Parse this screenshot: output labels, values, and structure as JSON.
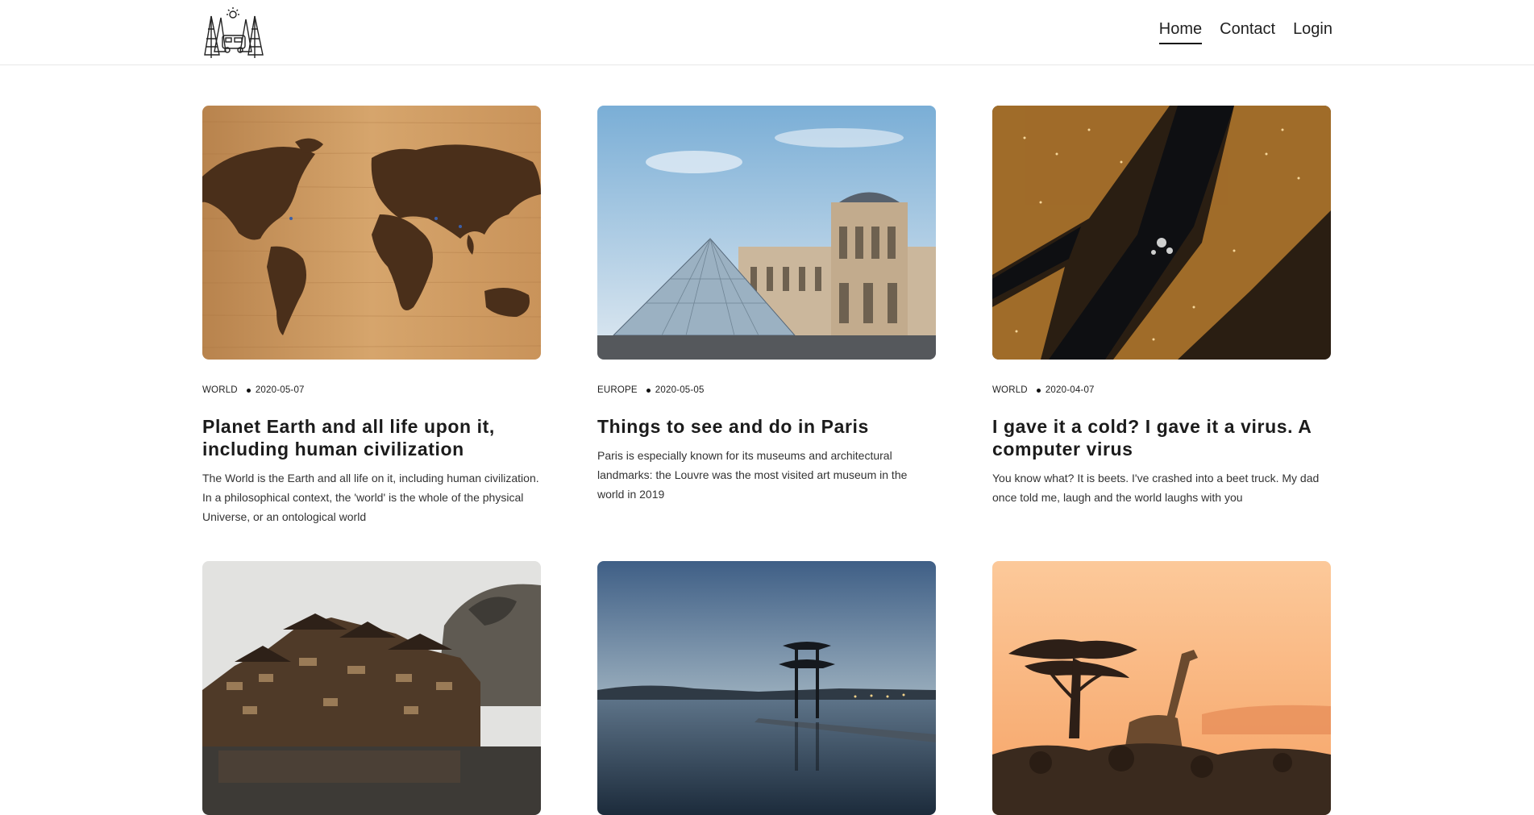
{
  "header": {
    "logo_icon": "camper-van-trees-sun-logo",
    "nav": [
      {
        "label": "Home",
        "active": true
      },
      {
        "label": "Contact",
        "active": false
      },
      {
        "label": "Login",
        "active": false
      }
    ]
  },
  "posts": [
    {
      "image_icon": "wooden-world-map-image",
      "category": "WORLD",
      "date": "2020-05-07",
      "title": "Planet Earth and all life upon it, including human civilization",
      "excerpt": "The World is the Earth and all life on it, including human civilization. In a philosophical context, the 'world' is the whole of the physical Universe, or an ontological world"
    },
    {
      "image_icon": "louvre-pyramid-image",
      "category": "EUROPE",
      "date": "2020-05-05",
      "title": "Things to see and do in Paris",
      "excerpt": "Paris is especially known for its museums and architectural landmarks: the Louvre was the most visited art museum in the world in 2019"
    },
    {
      "image_icon": "city-lights-aerial-image",
      "category": "WORLD",
      "date": "2020-04-07",
      "title": "I gave it a cold? I gave it a virus. A computer virus",
      "excerpt": "You know what? It is beets. I've crashed into a beet truck. My dad once told me, laugh and the world laughs with you"
    },
    {
      "image_icon": "riverside-old-town-image"
    },
    {
      "image_icon": "lake-pagoda-dusk-image"
    },
    {
      "image_icon": "savanna-giraffe-sunset-image"
    }
  ]
}
